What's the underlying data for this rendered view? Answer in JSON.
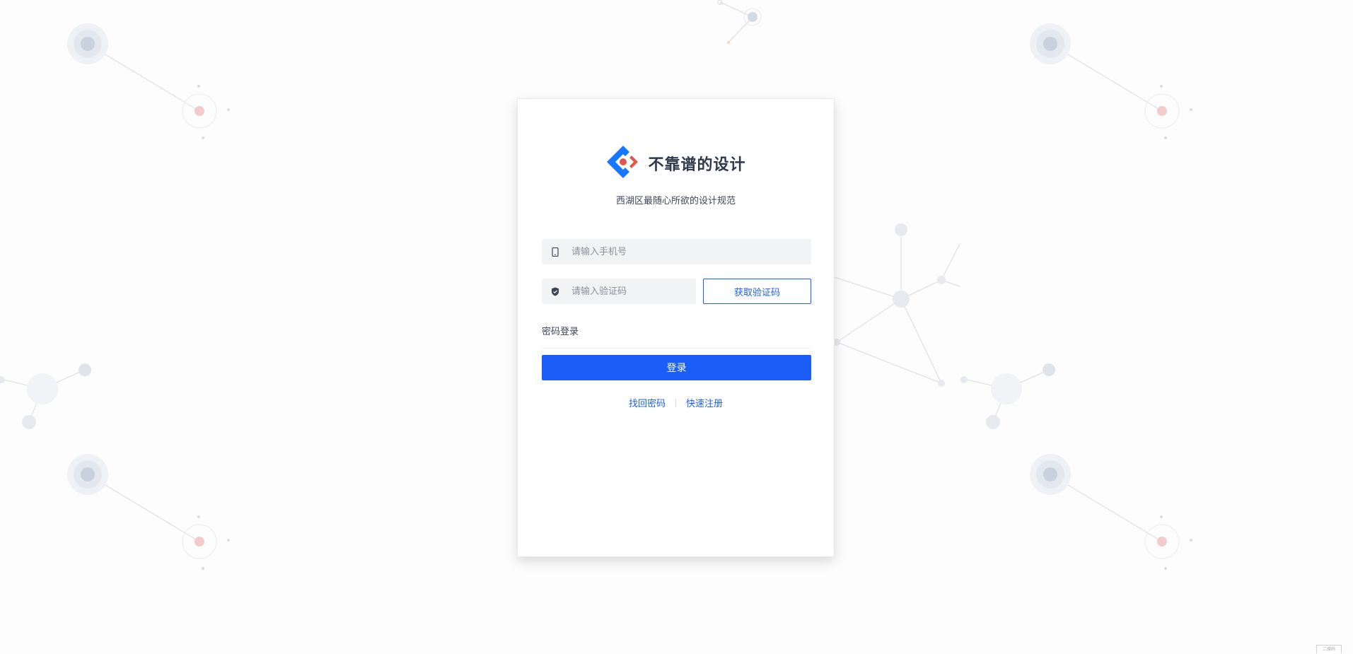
{
  "brand": {
    "name": "不靠谱的设计",
    "subtitle": "西湖区最随心所欲的设计规范",
    "logo_icon": "diamond-logo-icon",
    "colors": {
      "blue": "#1677ff",
      "red": "#e0574f"
    }
  },
  "form": {
    "phone_placeholder": "请输入手机号",
    "code_placeholder": "请输入验证码",
    "get_code_label": "获取验证码",
    "password_login_label": "密码登录",
    "login_label": "登录",
    "phone_icon": "mobile-phone-icon",
    "code_icon": "shield-check-icon"
  },
  "links": {
    "forgot_password": "找回密码",
    "quick_register": "快速注册"
  },
  "corner_badge": "二维码",
  "theme": {
    "primary": "#1b5ef7",
    "input_bg": "#f2f3f5",
    "page_bg": "#fdfdfd"
  }
}
